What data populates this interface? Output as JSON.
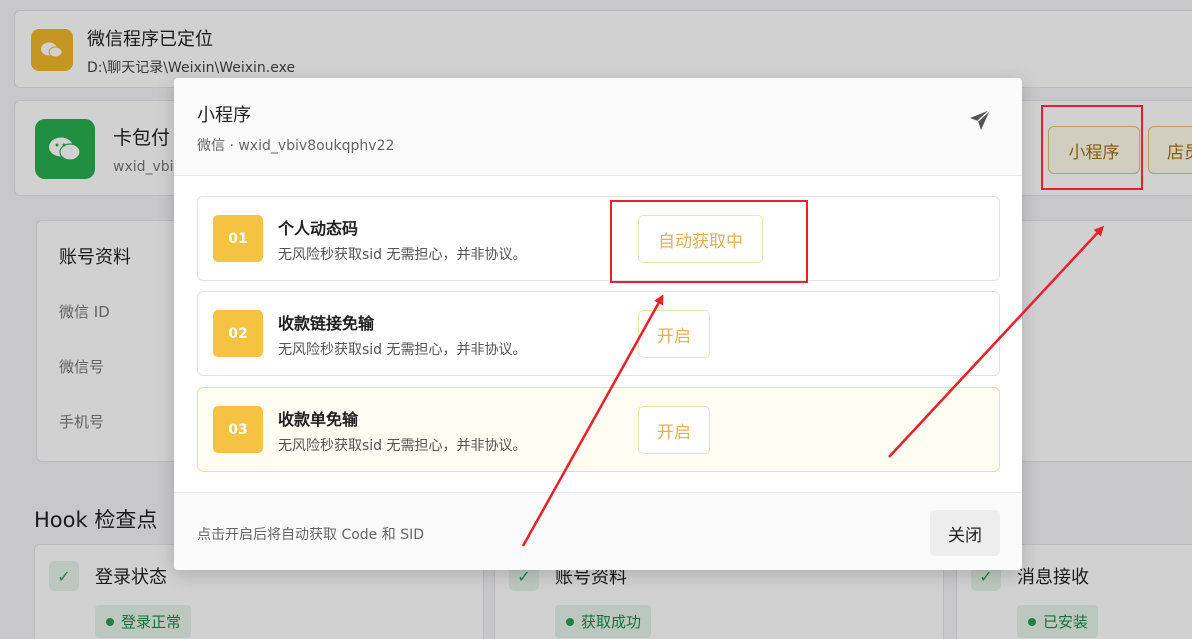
{
  "background": {
    "locate": {
      "title": "微信程序已定位",
      "path": "D:\\聊天记录\\Weixin\\Weixin.exe"
    },
    "account": {
      "name": "卡包付",
      "wxid": "wxid_vbiv"
    },
    "buttons": {
      "mini_program": "小程序",
      "store": "店员"
    },
    "profile": {
      "title": "账号资料",
      "labels": [
        "微信 ID",
        "微信号",
        "手机号"
      ]
    },
    "hook": {
      "title": "Hook 检查点",
      "items": [
        {
          "label": "登录状态",
          "badge": "登录正常"
        },
        {
          "label": "账号资料",
          "badge": "获取成功"
        },
        {
          "label": "消息接收",
          "badge": "已安装"
        }
      ]
    }
  },
  "modal": {
    "title": "小程序",
    "subtitle": "微信 · wxid_vbiv8oukqphv22",
    "features": [
      {
        "num": "01",
        "name": "个人动态码",
        "desc": "无风险秒获取sid 无需担心，并非协议。",
        "button": "自动获取中"
      },
      {
        "num": "02",
        "name": "收款链接免输",
        "desc": "无风险秒获取sid 无需担心，并非协议。",
        "button": "开启"
      },
      {
        "num": "03",
        "name": "收款单免输",
        "desc": "无风险秒获取sid 无需担心，并非协议。",
        "button": "开启"
      }
    ],
    "footer_hint": "点击开启后将自动获取 Code 和 SID",
    "close_label": "关闭"
  },
  "colors": {
    "accent": "#f5c341",
    "annotation": "#e8202a",
    "success": "#2a9d55"
  }
}
